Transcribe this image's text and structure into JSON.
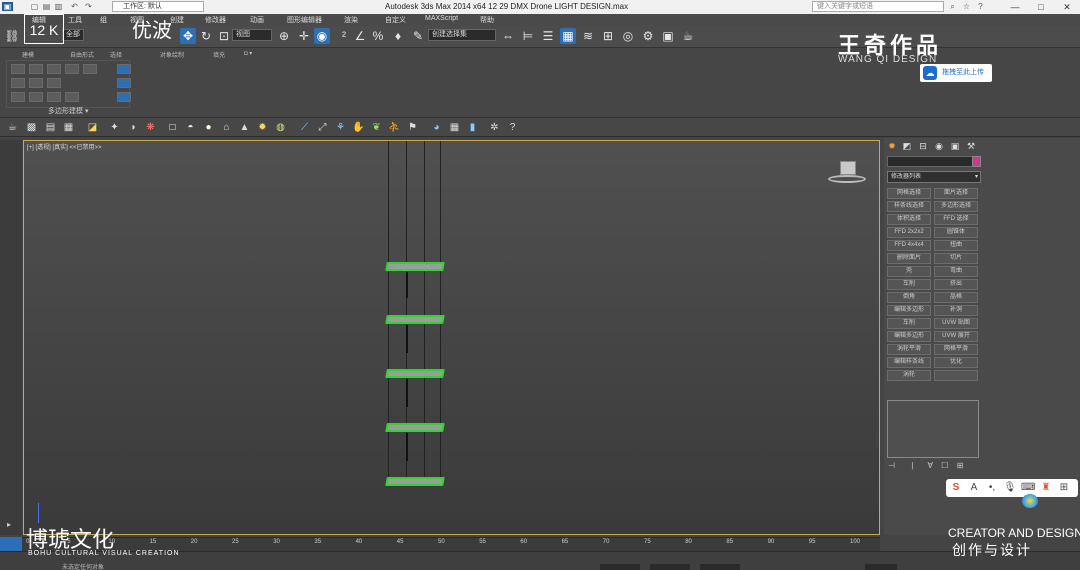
{
  "window": {
    "title": "Autodesk 3ds Max  2014 x64      12 29 DMX Drone LIGHT DESIGN.max",
    "workspace": "工作区: 默认",
    "search_placeholder": "键入关键字或短语",
    "controls": {
      "minimize": "—",
      "maximize": "□",
      "close": "✕"
    }
  },
  "menu": [
    "编辑",
    "工具",
    "组",
    "视图",
    "创建",
    "修改器",
    "动画",
    "图形编辑器",
    "渲染",
    "自定义",
    "MAXScript",
    "帮助"
  ],
  "toolbar": {
    "selection_set": "创建选择集",
    "ref_coord": "视图",
    "filter": "全部"
  },
  "ribbon": {
    "tabs": [
      "建模",
      "自由形式",
      "选择",
      "对象绘制",
      "填充"
    ],
    "panel_label": "多边形建模"
  },
  "viewport": {
    "label": "[+] [透视] [真实]   <<已禁用>>",
    "plate_count": 5
  },
  "command_panel": {
    "dropdown": "修改器列表",
    "buttons": [
      [
        "网格选择",
        "面片选择"
      ],
      [
        "样条线选择",
        "多边形选择"
      ],
      [
        "体积选择",
        "FFD 选择"
      ],
      [
        "FFD 2x2x2",
        "圆锥体"
      ],
      [
        "FFD 4x4x4",
        "扭曲"
      ],
      [
        "删除面片",
        "切片"
      ],
      [
        "壳",
        "弯曲"
      ],
      [
        "车削",
        "挤出"
      ],
      [
        "倒角",
        "晶格"
      ],
      [
        "编辑多边形",
        "补洞"
      ],
      [
        "车削",
        "UVW 贴图"
      ],
      [
        "编辑多边形",
        "UVW 展开"
      ],
      [
        "涡轮平滑",
        "网格平滑"
      ],
      [
        "编辑样条线",
        "优化"
      ],
      [
        "涡轮",
        ""
      ]
    ]
  },
  "timeline": {
    "ticks": [
      "0",
      "5",
      "10",
      "15",
      "20",
      "25",
      "30",
      "35",
      "40",
      "45",
      "50",
      "55",
      "60",
      "65",
      "70",
      "75",
      "80",
      "85",
      "90",
      "95",
      "100"
    ],
    "current_frame": "0 / 100"
  },
  "status": {
    "text": "未选定任何对象"
  },
  "watermarks": {
    "brand": "王奇作品",
    "brand_sub": "WANG QI DESIGN",
    "upload": "拖拽至此上传",
    "left_brand": "博琥文化",
    "left_sub": "BOHU CULTURAL VISUAL CREATION",
    "creator": "CREATOR AND DESIGN",
    "creator_sub": "创作与设计",
    "badge": "12 K",
    "script": "优波"
  },
  "ime": [
    "S",
    "A",
    "•,",
    "mic",
    "kbd",
    "shirt",
    "grid"
  ],
  "colors": {
    "accent": "#2d6fb5",
    "selection": "#2fd52f",
    "viewport_border": "#c9a94c",
    "swatch": "#cc3a8c"
  }
}
